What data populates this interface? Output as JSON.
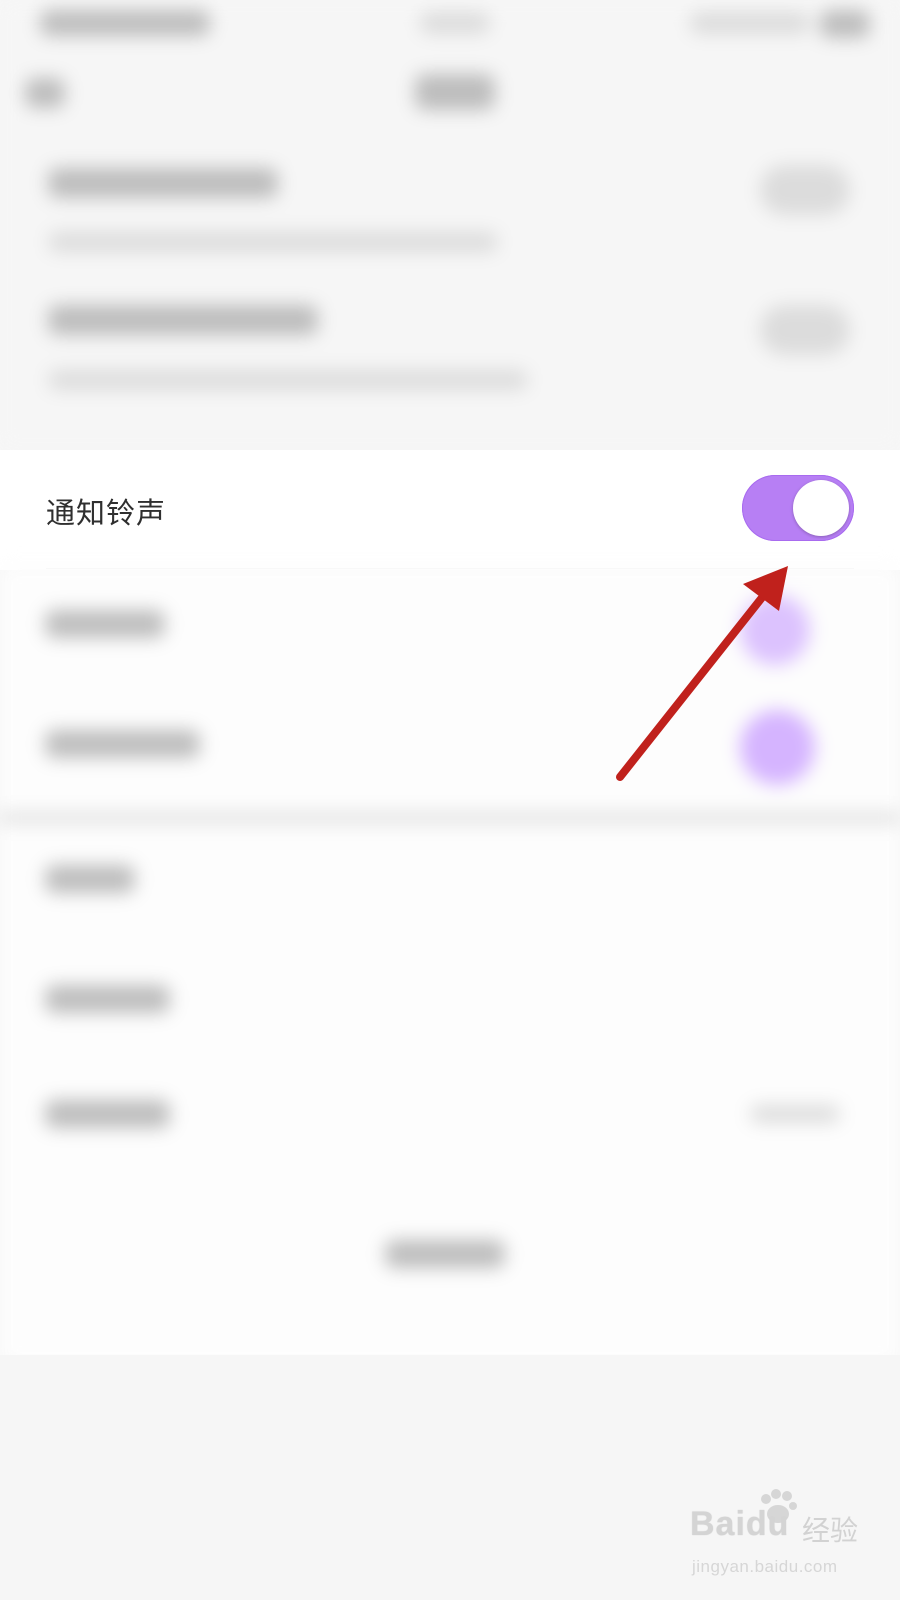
{
  "setting": {
    "label": "通知铃声",
    "toggle_on": true,
    "accent_color": "#b77ff4"
  },
  "annotation": {
    "arrow_color": "#c0211c"
  },
  "watermark": {
    "logo": "Baidu",
    "cn": "经验",
    "url": "jingyan.baidu.com"
  }
}
